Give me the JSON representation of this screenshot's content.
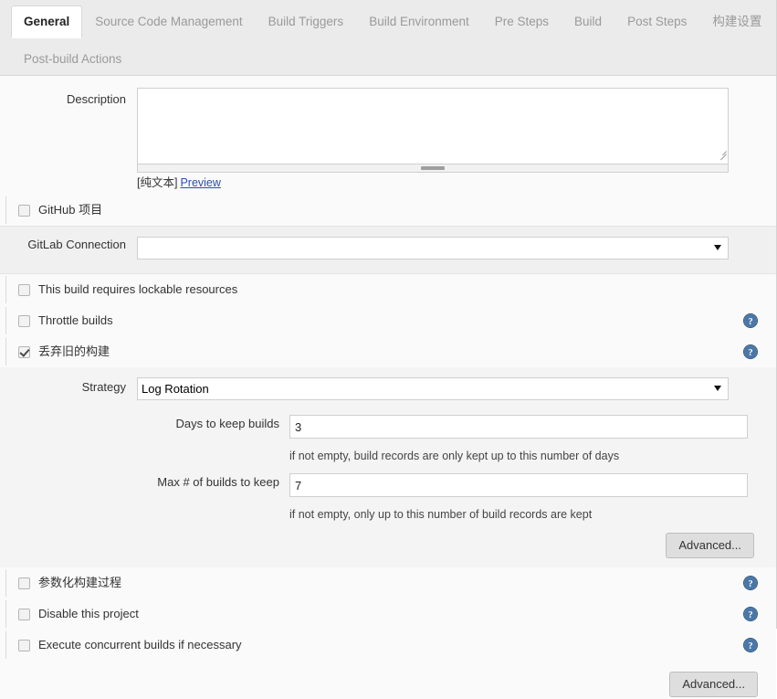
{
  "tabs": [
    {
      "label": "General",
      "active": true
    },
    {
      "label": "Source Code Management",
      "active": false
    },
    {
      "label": "Build Triggers",
      "active": false
    },
    {
      "label": "Build Environment",
      "active": false
    },
    {
      "label": "Pre Steps",
      "active": false
    },
    {
      "label": "Build",
      "active": false
    },
    {
      "label": "Post Steps",
      "active": false
    },
    {
      "label": "构建设置",
      "active": false
    },
    {
      "label": "Post-build Actions",
      "active": false
    }
  ],
  "description": {
    "label": "Description",
    "value": "",
    "placeholder": "",
    "plaintext_note": "[纯文本]",
    "preview_link": "Preview"
  },
  "github_project": {
    "label": "GitHub 项目",
    "checked": false
  },
  "gitlab_connection": {
    "label": "GitLab Connection",
    "value": "",
    "options": [
      ""
    ]
  },
  "lockable_resources": {
    "label": "This build requires lockable resources",
    "checked": false
  },
  "throttle_builds": {
    "label": "Throttle builds",
    "checked": false
  },
  "discard_old_builds": {
    "label": "丢弃旧的构建",
    "checked": true
  },
  "strategy": {
    "label": "Strategy",
    "value": "Log Rotation",
    "options": [
      "Log Rotation"
    ],
    "days_to_keep": {
      "label": "Days to keep builds",
      "value": "3",
      "hint": "if not empty, build records are only kept up to this number of days"
    },
    "max_builds_to_keep": {
      "label": "Max # of builds to keep",
      "value": "7",
      "hint": "if not empty, only up to this number of build records are kept"
    },
    "advanced_label": "Advanced..."
  },
  "parameterized_build": {
    "label": "参数化构建过程",
    "checked": false
  },
  "disable_project": {
    "label": "Disable this project",
    "checked": false
  },
  "concurrent_builds": {
    "label": "Execute concurrent builds if necessary",
    "checked": false
  },
  "footer": {
    "advanced_label": "Advanced..."
  },
  "icons": {
    "help": "help-icon",
    "dropdown": "chevron-down-icon",
    "resize": "resize-grip-icon"
  },
  "colors": {
    "active_tab_text": "#222222",
    "inactive_tab_text": "#9a9a9a",
    "link": "#2b50aa",
    "help_icon": "#31597d",
    "tabbar_bg": "#ebebeb",
    "page_bg": "#fafafa",
    "block_bg": "#f0f0f0"
  }
}
